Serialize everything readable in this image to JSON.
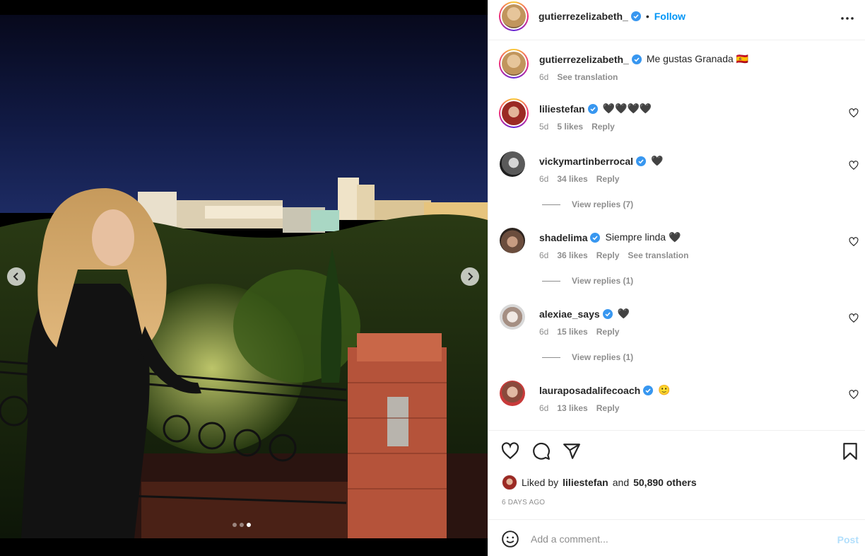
{
  "post": {
    "author": "gutierrezelizabeth_",
    "follow_label": "Follow",
    "separator": "•",
    "caption": "Me gustas Granada 🇪🇸",
    "caption_age": "6d",
    "see_translation": "See translation",
    "colors": {
      "accent": "#0095f6",
      "verified": "#3897f0",
      "muted": "#8e8e8e",
      "text": "#262626"
    }
  },
  "carousel": {
    "slides": 3,
    "active_slide": 3
  },
  "comments": [
    {
      "username": "liliestefan",
      "text": "🖤🖤🖤🖤",
      "age": "5d",
      "likes": "5 likes",
      "reply": "Reply"
    },
    {
      "username": "vickymartinberrocal",
      "text": "🖤",
      "age": "6d",
      "likes": "34 likes",
      "reply": "Reply",
      "view_replies": "View replies (7)"
    },
    {
      "username": "shadelima",
      "text": "Siempre linda 🖤",
      "age": "6d",
      "likes": "36 likes",
      "reply": "Reply",
      "translation": "See translation",
      "view_replies": "View replies (1)"
    },
    {
      "username": "alexiae_says",
      "text": "🖤",
      "age": "6d",
      "likes": "15 likes",
      "reply": "Reply",
      "view_replies": "View replies (1)"
    },
    {
      "username": "lauraposadalifecoach",
      "text": "🙂",
      "age": "6d",
      "likes": "13 likes",
      "reply": "Reply"
    }
  ],
  "engagement": {
    "liked_by_prefix": "Liked by",
    "liked_by_user": "liliestefan",
    "and": "and",
    "others": "50,890 others",
    "time_ago": "6 DAYS AGO"
  },
  "composer": {
    "placeholder": "Add a comment...",
    "post_label": "Post"
  }
}
